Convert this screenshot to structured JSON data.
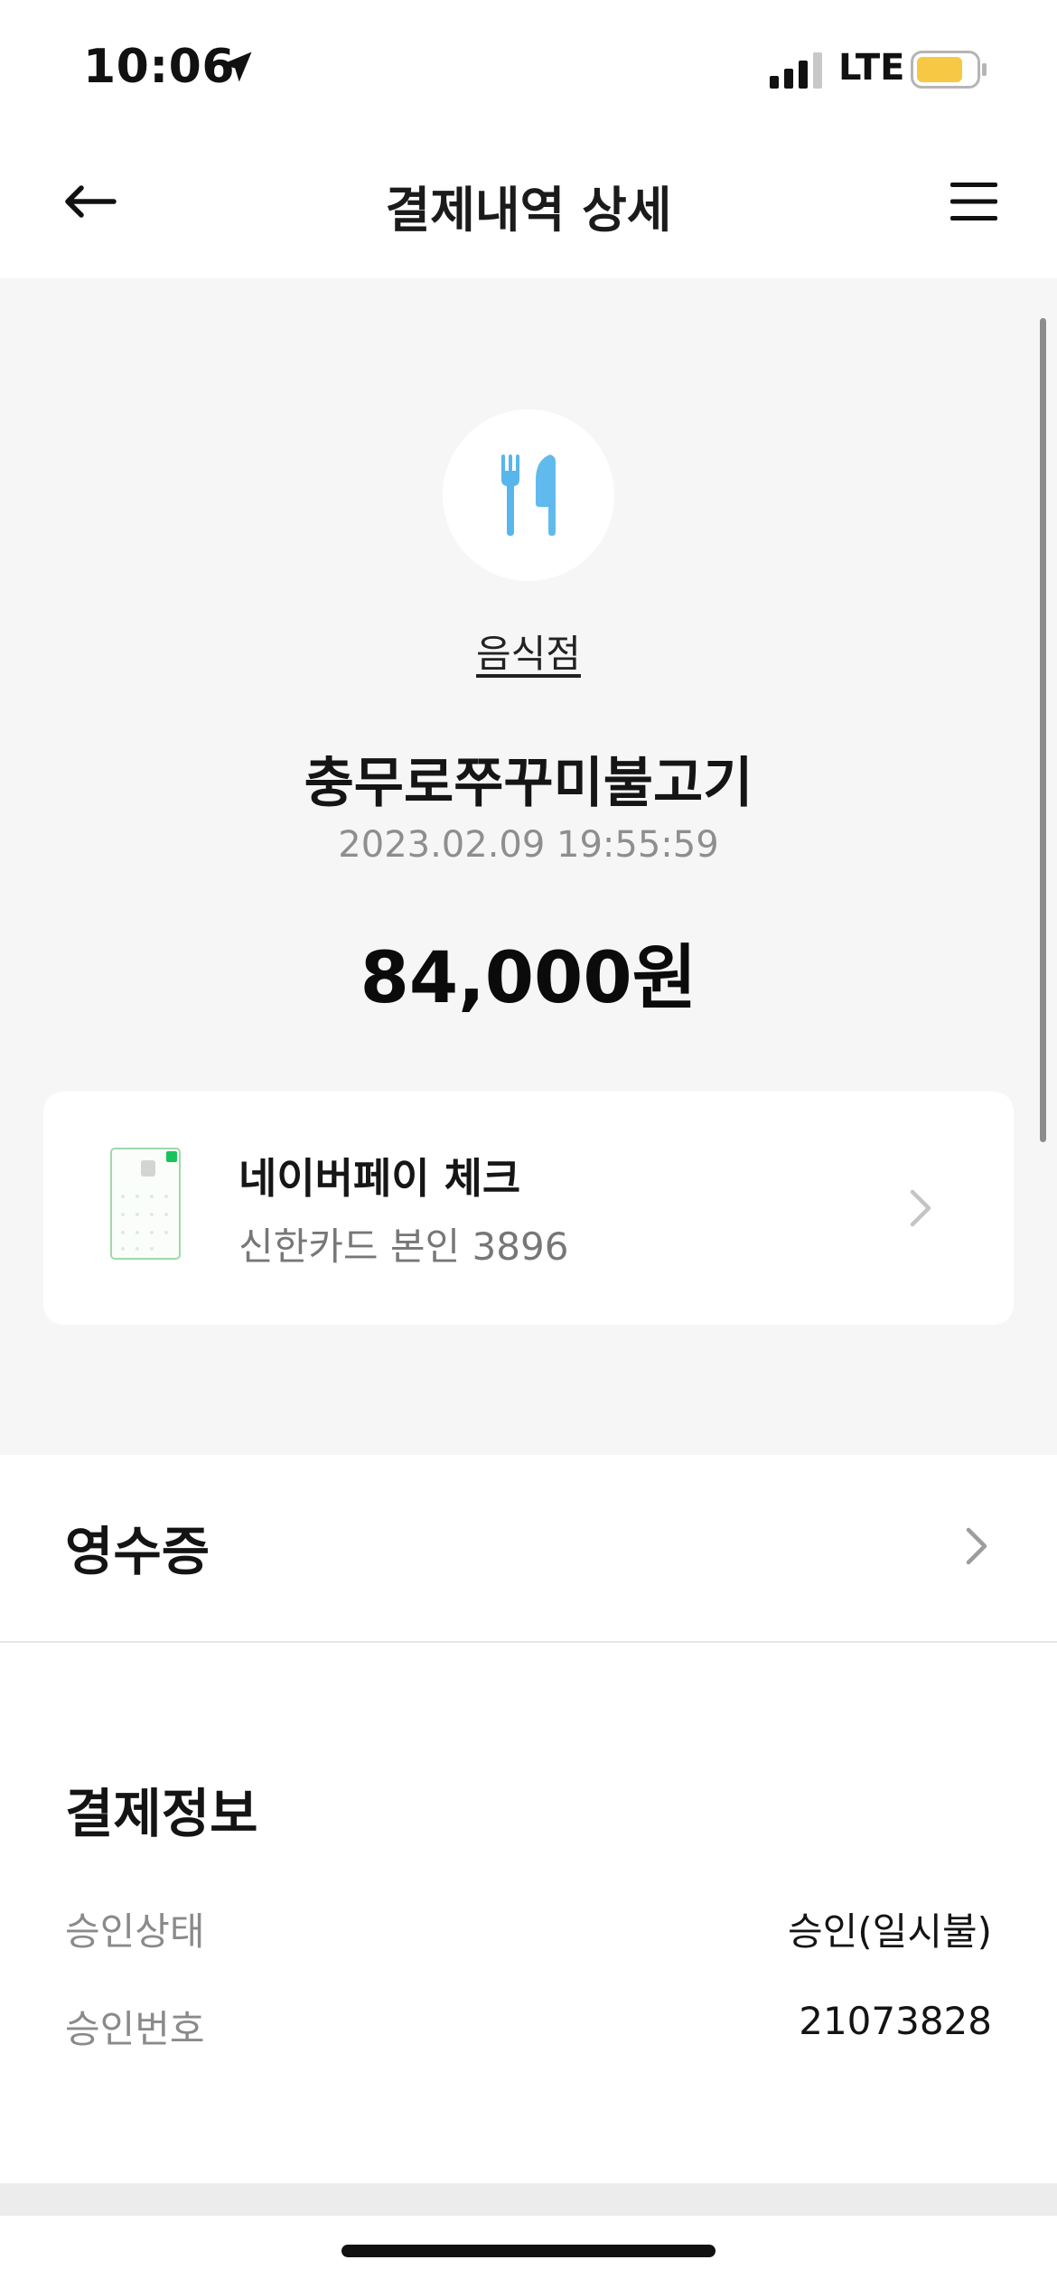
{
  "status_bar": {
    "time": "10:06",
    "network": "LTE",
    "battery_color": "#f7c844"
  },
  "header": {
    "title": "결제내역 상세",
    "back_icon": "arrow-left-icon",
    "menu_icon": "hamburger-menu-icon"
  },
  "summary": {
    "category_icon": "fork-knife-icon",
    "category_icon_color": "#59b6ec",
    "category": "음식점",
    "merchant": "충무로쭈꾸미불고기",
    "datetime": "2023.02.09 19:55:59",
    "amount": "84,000원"
  },
  "payment_method": {
    "card_name": "네이버페이 체크",
    "card_detail": "신한카드 본인 3896",
    "card_brand_color": "#19c35c"
  },
  "receipt": {
    "label": "영수증"
  },
  "payment_info": {
    "title": "결제정보",
    "rows": [
      {
        "label": "승인상태",
        "value": "승인(일시불)"
      },
      {
        "label": "승인번호",
        "value": "21073828"
      }
    ]
  }
}
